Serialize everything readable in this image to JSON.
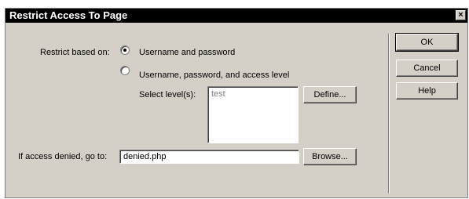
{
  "dialog": {
    "title": "Restrict Access To Page",
    "close_glyph": "×"
  },
  "restrict": {
    "label": "Restrict based on:",
    "option_username_password": "Username and password",
    "option_with_access_level": "Username, password, and access level",
    "selected_option": "Username and password"
  },
  "levels": {
    "label": "Select level(s):",
    "items": [
      "test"
    ],
    "define_button": "Define..."
  },
  "denied": {
    "label": "If access denied, go to:",
    "value": "denied.php",
    "browse_button": "Browse..."
  },
  "buttons": {
    "ok": "OK",
    "cancel": "Cancel",
    "help": "Help"
  }
}
